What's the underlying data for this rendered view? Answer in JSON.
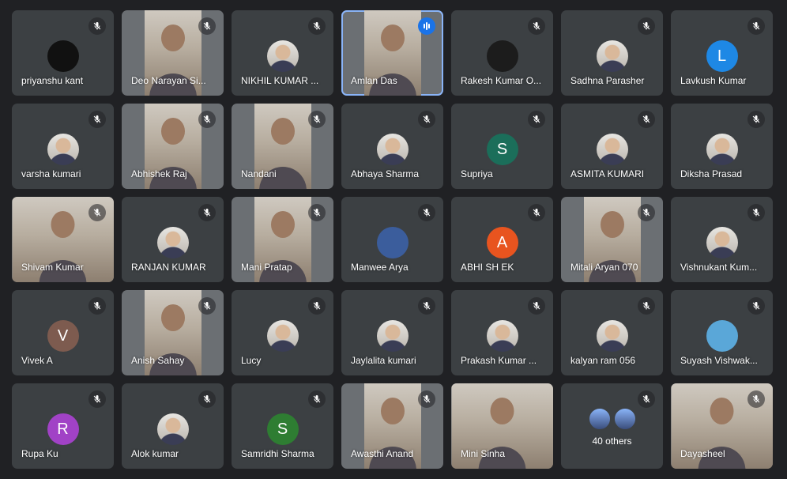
{
  "colors": {
    "background": "#202124",
    "tile": "#3c4043",
    "speaking_outline": "#8ab4f8",
    "speaking_badge": "#1a73e8"
  },
  "participants": [
    {
      "name": "priyanshu kant",
      "type": "avatar",
      "avatar_color": "#111111",
      "avatar_letter": "",
      "mic": "muted"
    },
    {
      "name": "Deo Narayan Si...",
      "type": "video",
      "mic": "muted"
    },
    {
      "name": "NIKHIL KUMAR ...",
      "type": "photo",
      "mic": "muted"
    },
    {
      "name": "Amlan Das",
      "type": "video",
      "mic": "speaking",
      "speaking": true
    },
    {
      "name": "Rakesh Kumar O...",
      "type": "avatar",
      "avatar_color": "#1c1c1c",
      "avatar_letter": "",
      "mic": "muted"
    },
    {
      "name": "Sadhna Parasher",
      "type": "photo",
      "mic": "muted"
    },
    {
      "name": "Lavkush Kumar",
      "type": "avatar",
      "avatar_color": "#1e88e5",
      "avatar_letter": "L",
      "mic": "muted"
    },
    {
      "name": "varsha kumari",
      "type": "photo",
      "mic": "muted"
    },
    {
      "name": "Abhishek Raj",
      "type": "video",
      "mic": "muted"
    },
    {
      "name": "Nandani",
      "type": "video",
      "mic": "muted"
    },
    {
      "name": "Abhaya Sharma",
      "type": "photo",
      "mic": "muted"
    },
    {
      "name": "Supriya",
      "type": "avatar",
      "avatar_color": "#1b6e5a",
      "avatar_letter": "S",
      "mic": "muted"
    },
    {
      "name": "ASMITA KUMARI",
      "type": "photo",
      "mic": "muted"
    },
    {
      "name": "Diksha Prasad",
      "type": "photo",
      "mic": "muted"
    },
    {
      "name": "Shivam Kumar",
      "type": "video-wide",
      "mic": "muted"
    },
    {
      "name": "RANJAN KUMAR",
      "type": "photo",
      "mic": "muted"
    },
    {
      "name": "Mani Pratap",
      "type": "video",
      "mic": "muted"
    },
    {
      "name": "Manwee Arya",
      "type": "avatar",
      "avatar_color": "#3b5d9c",
      "avatar_letter": "",
      "mic": "muted"
    },
    {
      "name": "ABHI SH EK",
      "type": "avatar",
      "avatar_color": "#e8541f",
      "avatar_letter": "A",
      "mic": "muted"
    },
    {
      "name": "Mitali Aryan 070",
      "type": "video",
      "mic": "muted"
    },
    {
      "name": "Vishnukant Kum...",
      "type": "photo",
      "mic": "muted"
    },
    {
      "name": "Vivek A",
      "type": "avatar",
      "avatar_color": "#7d5b4f",
      "avatar_letter": "V",
      "mic": "muted"
    },
    {
      "name": "Anish Sahay",
      "type": "video",
      "mic": "muted"
    },
    {
      "name": "Lucy",
      "type": "photo",
      "mic": "muted"
    },
    {
      "name": "Jaylalita kumari",
      "type": "photo",
      "mic": "muted"
    },
    {
      "name": "Prakash Kumar ...",
      "type": "photo",
      "mic": "muted"
    },
    {
      "name": "kalyan ram 056",
      "type": "photo",
      "mic": "muted"
    },
    {
      "name": "Suyash Vishwak...",
      "type": "avatar",
      "avatar_color": "#5aa7d8",
      "avatar_letter": "",
      "mic": "muted"
    },
    {
      "name": "Rupa Ku",
      "type": "avatar",
      "avatar_color": "#a142c6",
      "avatar_letter": "R",
      "mic": "muted"
    },
    {
      "name": "Alok kumar",
      "type": "photo",
      "mic": "muted"
    },
    {
      "name": "Samridhi Sharma",
      "type": "avatar",
      "avatar_color": "#2e7d32",
      "avatar_letter": "S",
      "mic": "muted"
    },
    {
      "name": "Awasthi Anand",
      "type": "video",
      "mic": "muted"
    },
    {
      "name": "Mini Sinha",
      "type": "video-wide",
      "mic": "none"
    },
    {
      "name": "40 others",
      "type": "others",
      "mic": "muted"
    },
    {
      "name": "Dayasheel",
      "type": "video-wide",
      "mic": "muted"
    }
  ],
  "icons": {
    "mic_muted": "mic-off-icon",
    "speaking": "audio-wave-icon"
  }
}
